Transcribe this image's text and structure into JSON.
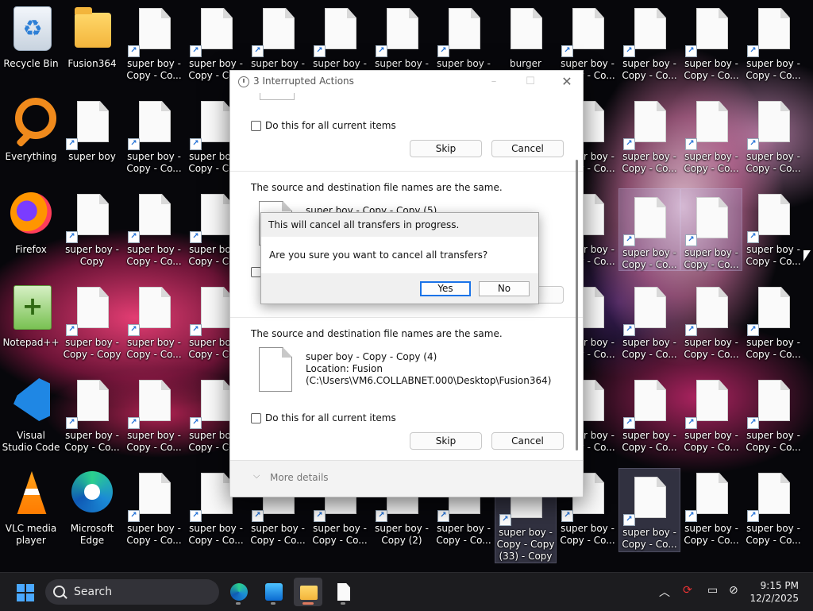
{
  "desktop": {
    "apps": [
      {
        "label": "Recycle Bin",
        "icon": "recycle-bin-icon"
      },
      {
        "label": "Fusion364",
        "icon": "folder-icon"
      },
      {
        "label": "Everything",
        "icon": "everything-search-icon"
      },
      {
        "label": "Firefox",
        "icon": "firefox-icon"
      },
      {
        "label": "Notepad++",
        "icon": "notepad-plus-plus-icon"
      },
      {
        "label": "Visual Studio Code",
        "icon": "vscode-icon"
      },
      {
        "label": "VLC media player",
        "icon": "vlc-icon"
      },
      {
        "label": "Microsoft Edge",
        "icon": "edge-icon"
      }
    ],
    "files": {
      "copy_co": "super boy - Copy - Co...",
      "super_boy": "super boy",
      "super_boy_copy": "super boy - Copy",
      "copy_copy": "super boy - Copy - Copy",
      "copy_2": "super boy - Copy (2)",
      "copy_33": "super boy - Copy - Copy (33) - Copy",
      "burger": "burger burger",
      "partial": "super boy"
    }
  },
  "dialog": {
    "title": "3 Interrupted Actions",
    "minimize": "–",
    "maximize": "☐",
    "close": "✕",
    "top_section": {
      "checkbox_label": "Do this for all current items",
      "skip": "Skip",
      "cancel": "Cancel"
    },
    "middle_section": {
      "heading": "The source and destination file names are the same.",
      "file_name": "super boy - Copy - Copy (5)"
    },
    "bottom_section": {
      "heading": "The source and destination file names are the same.",
      "file_name": "super boy - Copy - Copy (4)",
      "location_line": "Location: Fusion",
      "path_line": "(C:\\Users\\VM6.COLLABNET.000\\Desktop\\Fusion364)",
      "checkbox_label": "Do this for all current items",
      "skip": "Skip",
      "cancel": "Cancel"
    },
    "more_details": "More details"
  },
  "confirm": {
    "title": "This will cancel all transfers in progress.",
    "message": "Are you sure you want to cancel all transfers?",
    "yes": "Yes",
    "no": "No"
  },
  "taskbar": {
    "search_label": "Search",
    "time": "9:15 PM",
    "date": "12/2/2025"
  }
}
